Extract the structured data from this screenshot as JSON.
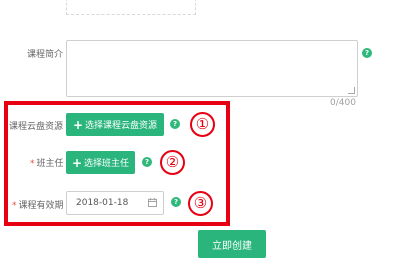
{
  "form": {
    "course_intro": {
      "label": "课程简介",
      "char_counter": "0/400",
      "help": "?"
    },
    "cloud_resource": {
      "label": "课程云盘资源",
      "button_icon": "+",
      "button_label": "选择课程云盘资源",
      "help": "?"
    },
    "head_teacher": {
      "required_mark": "*",
      "label": "班主任",
      "button_icon": "+",
      "button_label": "选择班主任",
      "help": "?"
    },
    "validity": {
      "required_mark": "*",
      "label": "课程有效期",
      "date_value": "2018-01-18",
      "calendar_icon": "calendar-icon",
      "help": "?"
    },
    "submit_label": "立即创建"
  },
  "annotations": {
    "marker_1": "①",
    "marker_2": "②",
    "marker_3": "③",
    "highlight_color": "#e60012"
  },
  "colors": {
    "accent": "#29b57b",
    "help_badge": "#2eb87a"
  }
}
